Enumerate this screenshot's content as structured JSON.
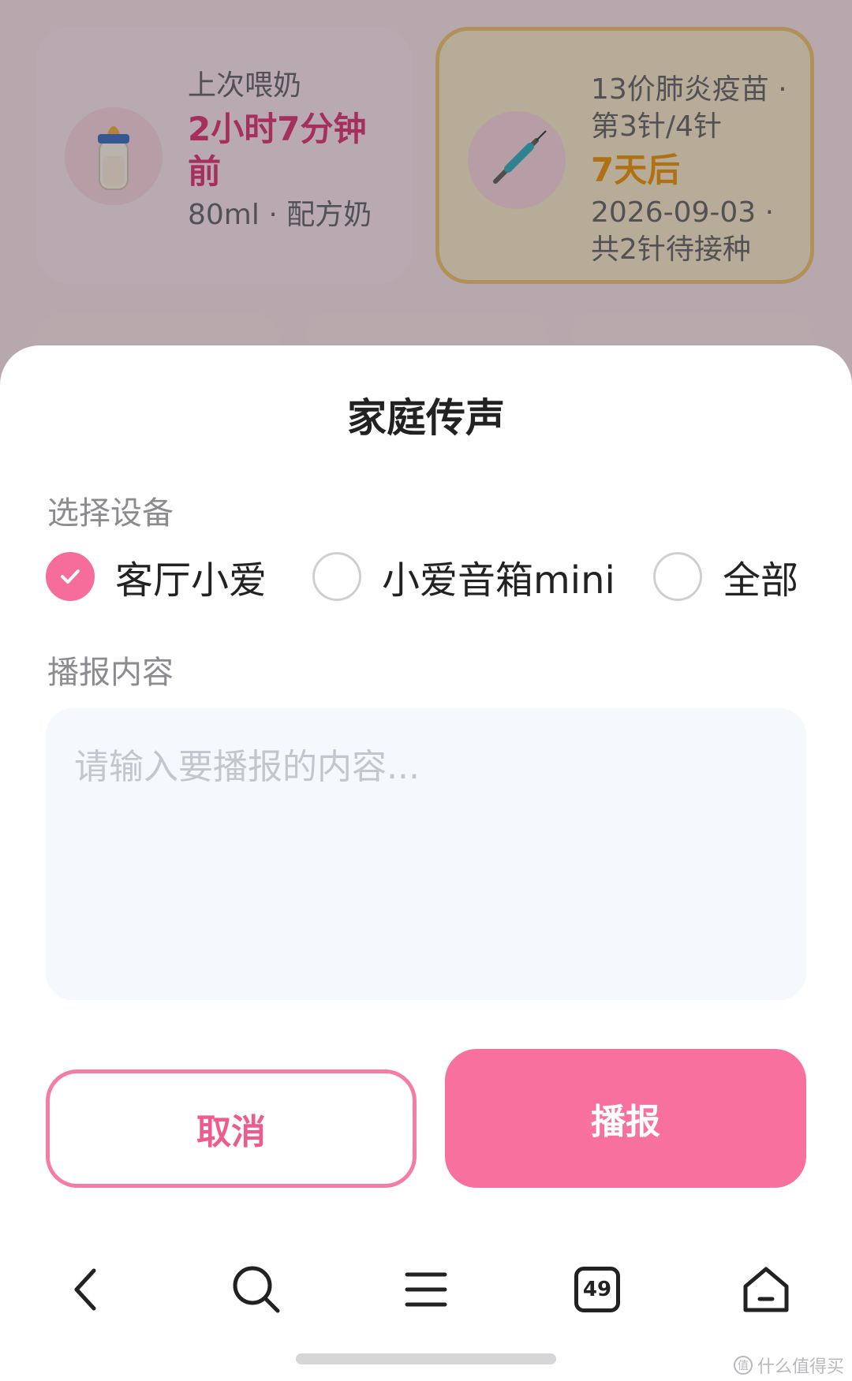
{
  "background": {
    "feeding_card": {
      "icon": "baby-bottle-icon",
      "label": "上次喂奶",
      "time": "2小时7分钟前",
      "detail": "80ml · 配方奶"
    },
    "vaccine_card": {
      "icon": "syringe-icon",
      "title": "13价肺炎疫苗 · 第3针/4针",
      "countdown": "7天后",
      "detail": "2026-09-03 · 共2针待接种"
    }
  },
  "dialog": {
    "title": "家庭传声",
    "device_label": "选择设备",
    "devices": [
      {
        "label": "客厅小爱",
        "checked": true
      },
      {
        "label": "小爱音箱mini",
        "checked": false
      },
      {
        "label": "全部",
        "checked": false
      }
    ],
    "content_label": "播报内容",
    "content_placeholder": "请输入要播报的内容...",
    "cancel_label": "取消",
    "broadcast_label": "播报"
  },
  "navbar": {
    "items": [
      "back-icon",
      "search-icon",
      "menu-icon",
      "tabs-icon",
      "home-icon"
    ],
    "tab_count": "49"
  },
  "watermark": {
    "icon": "值",
    "text": "什么值得买"
  },
  "colors": {
    "accent": "#f8719e",
    "accent_text": "#ee5c8f",
    "vaccine_orange": "#f29c1e"
  }
}
